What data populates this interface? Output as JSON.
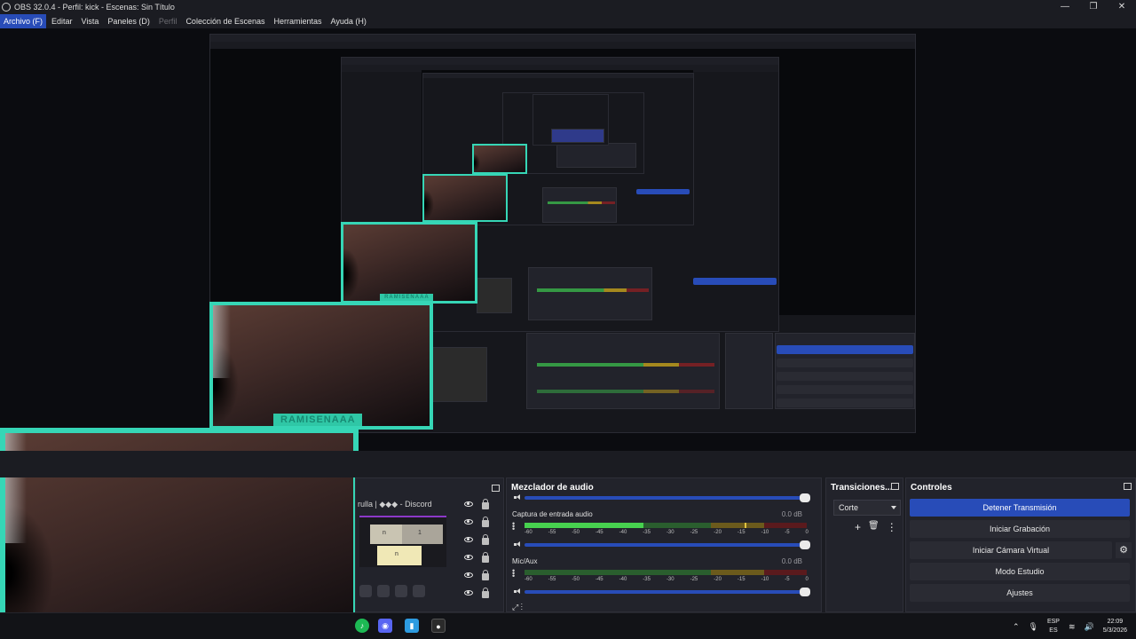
{
  "window": {
    "title": "OBS 32.0.4 - Perfil: kick - Escenas: Sin Título",
    "controls": [
      "—",
      "❐",
      "✕"
    ]
  },
  "menu": [
    {
      "label": "Archivo (F)",
      "state": "active"
    },
    {
      "label": "Editar",
      "state": "normal"
    },
    {
      "label": "Vista",
      "state": "normal"
    },
    {
      "label": "Paneles (D)",
      "state": "normal"
    },
    {
      "label": "Perfil",
      "state": "disabled"
    },
    {
      "label": "Colección de Escenas",
      "state": "normal"
    },
    {
      "label": "Herramientas",
      "state": "normal"
    },
    {
      "label": "Ayuda (H)",
      "state": "normal"
    }
  ],
  "preview": {
    "overlay_tag": "RAMISENAAA"
  },
  "sources": {
    "item_label": "rulla | ◆◆◆ - Discord",
    "thumb_labels": [
      "n",
      "1",
      "n"
    ]
  },
  "mixer": {
    "title": "Mezclador de audio",
    "scale": [
      "-60",
      "-55",
      "-50",
      "-45",
      "-40",
      "-35",
      "-30",
      "-25",
      "-20",
      "-15",
      "-10",
      "-5",
      "0"
    ],
    "tracks": [
      {
        "name": "Captura de entrada audio",
        "db": "0.0 dB",
        "level": 0.42,
        "peak": 0.78
      },
      {
        "name": "Mic/Aux",
        "db": "0.0 dB",
        "level": 0.0,
        "peak": 0.0
      }
    ]
  },
  "transitions": {
    "title": "Transiciones...",
    "selected": "Corte",
    "icons": [
      "+",
      "🗑",
      "⋮"
    ]
  },
  "controls": {
    "title": "Controles",
    "buttons": [
      {
        "label": "Detener Transmisión",
        "primary": true
      },
      {
        "label": "Iniciar Grabación",
        "primary": false
      },
      {
        "label": "Iniciar Cámara Virtual",
        "primary": false
      },
      {
        "label": "Modo Estudio",
        "primary": false
      },
      {
        "label": "Ajustes",
        "primary": false
      }
    ]
  },
  "taskbar": {
    "lang_top": "ESP",
    "lang_bottom": "ES",
    "time": "22:09",
    "date": "5/3/2026"
  },
  "colors": {
    "accent": "#284cb8",
    "camera_border": "#36d6b6",
    "meter_green": "#3ab54a",
    "meter_yellow": "#c6a21b",
    "meter_red": "#8a1f22"
  }
}
